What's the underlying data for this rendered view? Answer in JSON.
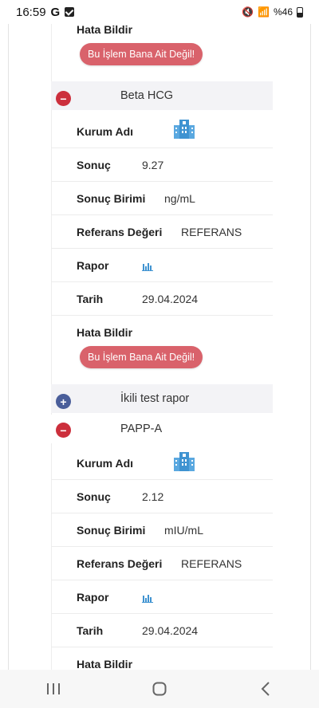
{
  "status": {
    "time": "16:59",
    "g": "G",
    "battery": "%46"
  },
  "labels": {
    "kurum": "Kurum Adı",
    "sonuc": "Sonuç",
    "birim": "Sonuç Birimi",
    "referans": "Referans Değeri",
    "rapor": "Rapor",
    "tarih": "Tarih",
    "hata": "Hata Bildir",
    "hata_button": "Bu İşlem Bana Ait Değil!"
  },
  "tests": [
    {
      "name": "Beta HCG",
      "sonuc": "9.27",
      "birim": "ng/mL",
      "referans": "REFERANS",
      "tarih": "29.04.2024"
    },
    {
      "name": "PAPP-A",
      "sonuc": "2.12",
      "birim": "mIU/mL",
      "referans": "REFERANS",
      "tarih": "29.04.2024"
    }
  ],
  "group_collapsed": {
    "name": "İkili test rapor"
  },
  "colors": {
    "error_button": "#d9626b",
    "minus_toggle": "#cc2f3c",
    "plus_toggle": "#4a5e9a",
    "icon_blue": "#3f93d1"
  },
  "icons": {
    "hospital": "hospital-building-icon",
    "report": "bar-chart-icon"
  }
}
